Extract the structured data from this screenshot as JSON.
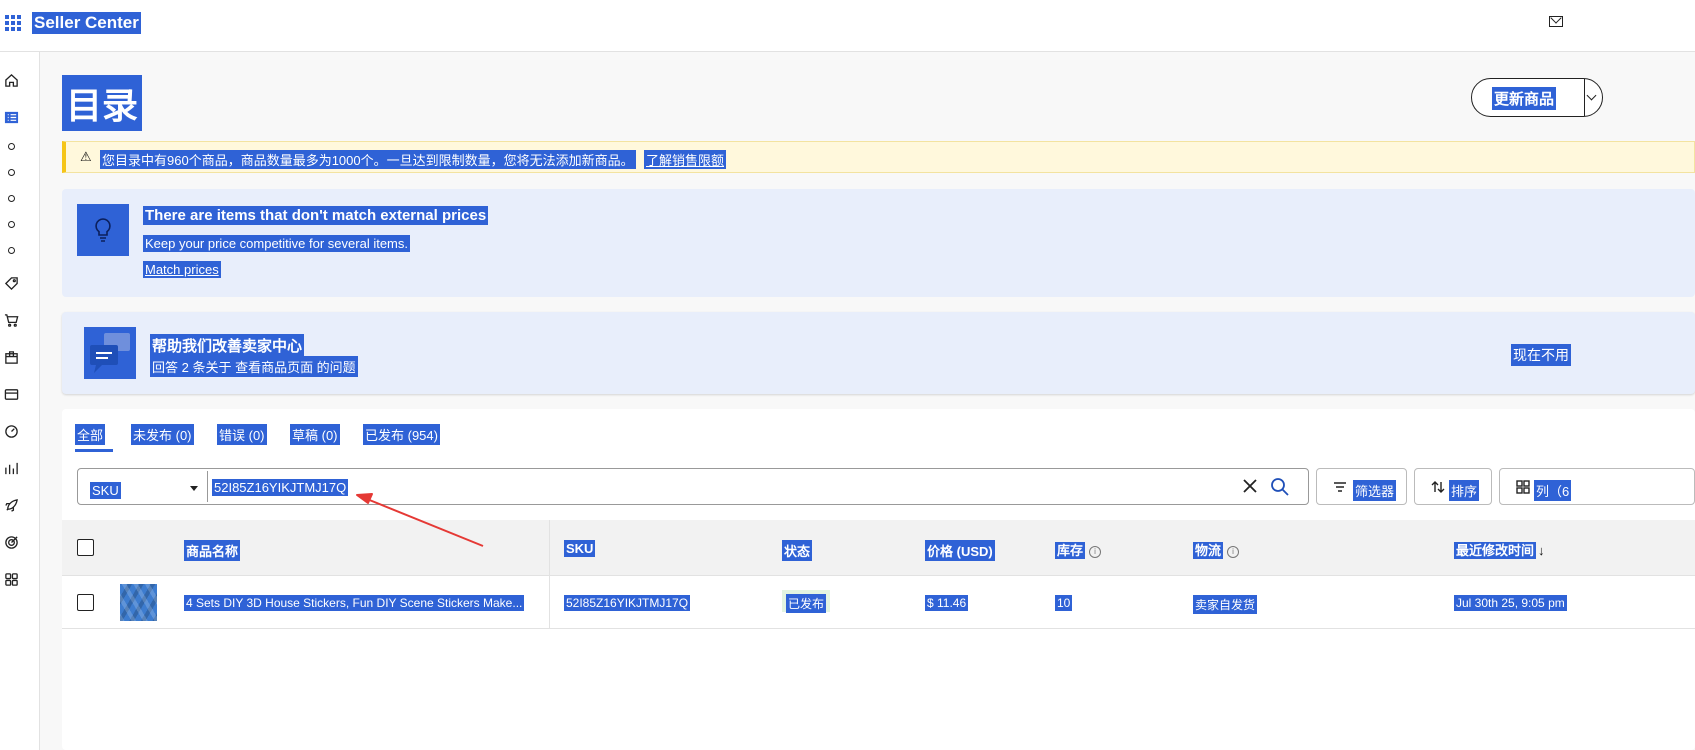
{
  "app": {
    "title": "Seller Center"
  },
  "page": {
    "title": "目录",
    "update_button": "更新商品"
  },
  "alert": {
    "message": "您目录中有960个商品，商品数量最多为1000个。一旦达到限制数量，您将无法添加新商品。",
    "link": "了解销售限额"
  },
  "price_card": {
    "title": "There are items that don't match external prices",
    "subtitle": "Keep your price competitive for several items.",
    "link": "Match prices"
  },
  "survey_card": {
    "title": "帮助我们改善卖家中心",
    "subtitle": "回答 2 条关于 查看商品页面 的问题",
    "later": "现在不用"
  },
  "tabs": [
    {
      "label": "全部"
    },
    {
      "label": "未发布 (0)"
    },
    {
      "label": "错误 (0)"
    },
    {
      "label": "草稿 (0)"
    },
    {
      "label": "已发布 (954)"
    }
  ],
  "search": {
    "field": "SKU",
    "value": "52I85Z16YIKJTMJ17Q"
  },
  "toolbar": {
    "filter": "筛选器",
    "sort": "排序",
    "columns": "列（6"
  },
  "table": {
    "headers": {
      "name": "商品名称",
      "sku": "SKU",
      "status": "状态",
      "price": "价格 (USD)",
      "inventory": "库存",
      "fulfillment": "物流",
      "modified": "最近修改时间"
    },
    "rows": [
      {
        "name": "4 Sets DIY 3D House Stickers, Fun DIY Scene Stickers Make...",
        "sku": "52I85Z16YIKJTMJ17Q",
        "status": "已发布",
        "price": "$ 11.46",
        "inventory": "10",
        "fulfillment": "卖家自发货",
        "modified": "Jul 30th 25, 9:05 pm"
      }
    ]
  },
  "colors": {
    "selection": "#2f62d6",
    "alert_bg": "#fff8dc",
    "card_bg": "#e8eefb",
    "annotation_arrow": "#e53935"
  }
}
